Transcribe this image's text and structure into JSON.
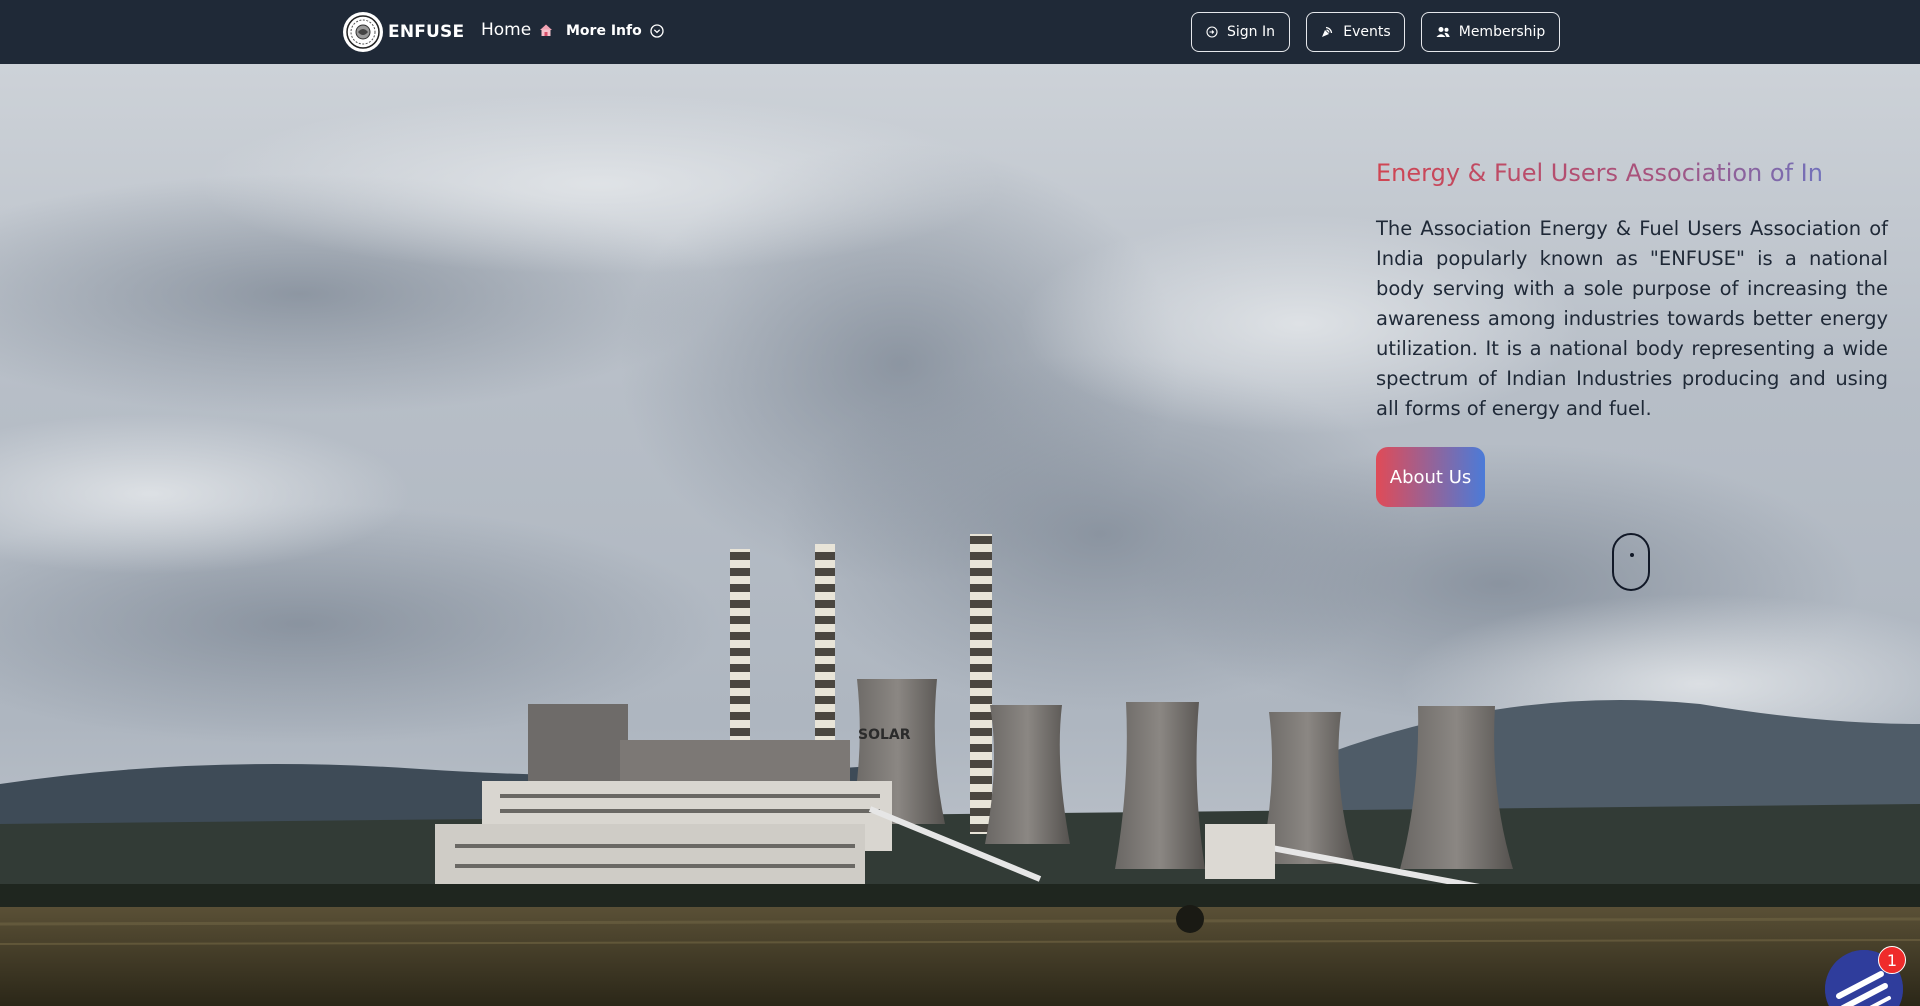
{
  "navbar": {
    "brand_name": "ENFUSE",
    "home_label": "Home",
    "more_info_label": "More Info",
    "signin_label": "Sign In",
    "events_label": "Events",
    "membership_label": "Membership"
  },
  "hero": {
    "title": "Energy & Fuel Users Association of In",
    "description": "The Association Energy & Fuel Users Association of India popularly known as \"ENFUSE\" is a national body serving with a sole purpose of increasing the awareness among industries towards better energy utilization. It is a national body representing a wide spectrum of Indian Industries producing and using all forms of energy and fuel.",
    "about_button_label": "About Us",
    "plant_sign": "SOLAR"
  },
  "chat": {
    "badge_count": "1"
  },
  "colors": {
    "navbar_bg": "#1f2937",
    "title_gradient_start": "#d04552",
    "title_gradient_end": "#5a7fd6",
    "about_button_start": "#e04b57",
    "about_button_end": "#4b7bd8",
    "badge": "#ef2b2b"
  },
  "icons": {
    "brand": "emblem-logo-icon",
    "home": "home-icon",
    "more_info": "chevron-down-circle-icon",
    "signin": "login-circle-icon",
    "events": "broadcast-icon",
    "membership": "users-icon",
    "scroll": "mouse-scroll-icon",
    "chat": "chat-widget-icon"
  }
}
